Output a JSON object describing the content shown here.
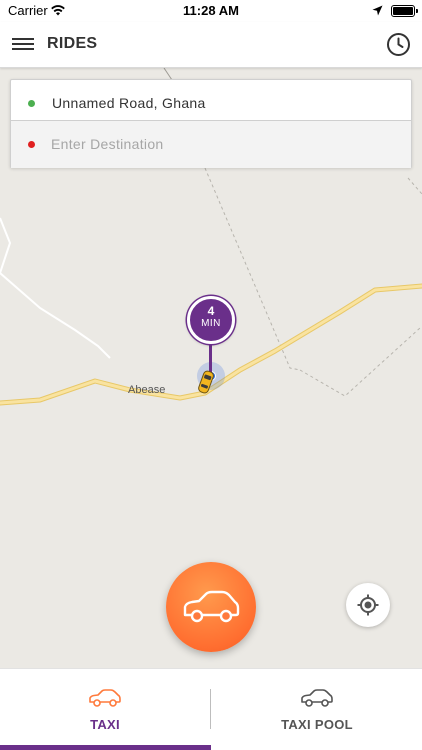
{
  "status_bar": {
    "carrier": "Carrier",
    "time": "11:28 AM"
  },
  "header": {
    "title": "RIDES",
    "menu_icon": "hamburger-menu-icon",
    "history_icon": "clock-icon"
  },
  "search": {
    "pickup_text": "Unnamed Road, Ghana",
    "destination_value": "",
    "destination_placeholder": "Enter Destination"
  },
  "map": {
    "place_label": "Abease",
    "eta_value": "4",
    "eta_unit": "MIN"
  },
  "tabs": [
    {
      "label": "TAXI",
      "icon": "car-icon",
      "selected": true
    },
    {
      "label": "TAXI POOL",
      "icon": "car-icon",
      "selected": false
    }
  ],
  "colors": {
    "accent_purple": "#6a2f8a",
    "orange": "#ff7a3c",
    "map_background": "#ebe9e4",
    "road_yellow": "#f6d77f"
  }
}
